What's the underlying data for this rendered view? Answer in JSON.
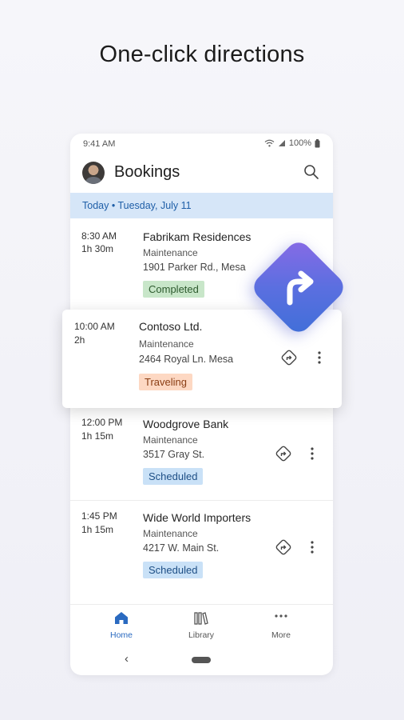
{
  "headline": "One-click directions",
  "status_bar": {
    "time": "9:41 AM",
    "battery": "100%"
  },
  "header": {
    "title": "Bookings"
  },
  "date_band": "Today • Tuesday, July 11",
  "bookings": [
    {
      "time": "8:30 AM",
      "duration": "1h 30m",
      "name": "Fabrikam Residences",
      "type": "Maintenance",
      "address": "1901 Parker Rd., Mesa",
      "status": "Completed"
    },
    {
      "time": "10:00 AM",
      "duration": "2h",
      "name": "Contoso Ltd.",
      "type": "Maintenance",
      "address": "2464 Royal Ln. Mesa",
      "status": "Traveling"
    },
    {
      "time": "12:00 PM",
      "duration": "1h 15m",
      "name": "Woodgrove Bank",
      "type": "Maintenance",
      "address": "3517 Gray St.",
      "status": "Scheduled"
    },
    {
      "time": "1:45 PM",
      "duration": "1h 15m",
      "name": "Wide World Importers",
      "type": "Maintenance",
      "address": "4217 W. Main St.",
      "status": "Scheduled"
    }
  ],
  "bottom_nav": {
    "home": "Home",
    "library": "Library",
    "more": "More"
  },
  "colors": {
    "accent": "#2a6ac0",
    "date_band": "#d6e6f8",
    "completed": "#c8e6c9",
    "traveling": "#fdd8c3",
    "scheduled": "#c9e1f7"
  }
}
